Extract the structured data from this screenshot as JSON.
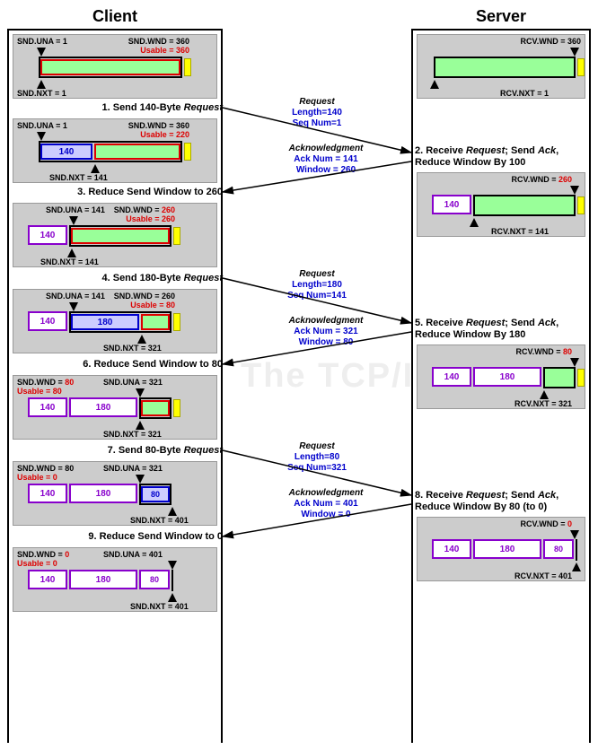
{
  "headers": {
    "client": "Client",
    "server": "Server"
  },
  "watermark": "The TCP/IP Guide",
  "steps": {
    "s1": "1. Send 140-Byte <em>Request</em>",
    "s2": "2. Receive <em>Request</em>; Send <em>Ack</em>, Reduce Window By 100",
    "s3": "3. Reduce Send Window to 260",
    "s4": "4. Send 180-Byte <em>Request</em>",
    "s5": "5. Receive <em>Request</em>; Send <em>Ack</em>, Reduce Window By 180",
    "s6": "6. Reduce Send Window to 80",
    "s7": "7. Send 80-Byte <em>Request</em>",
    "s8": "8. Receive <em>Request</em>; Send <em>Ack</em>, Reduce Window By 80 (to 0)",
    "s9": "9. Reduce Send Window to 0"
  },
  "msgs": {
    "req1": {
      "title": "Request",
      "l1": "Length=140",
      "l2": "Seq Num=1"
    },
    "ack1": {
      "title": "Acknowledgment",
      "l1": "Ack Num = 141",
      "l2": "Window = 260"
    },
    "req2": {
      "title": "Request",
      "l1": "Length=180",
      "l2": "Seq Num=141"
    },
    "ack2": {
      "title": "Acknowledgment",
      "l1": "Ack Num = 321",
      "l2": "Window = 80"
    },
    "req3": {
      "title": "Request",
      "l1": "Length=80",
      "l2": "Seq Num=321"
    },
    "ack3": {
      "title": "Acknowledgment",
      "l1": "Ack Num = 401",
      "l2": "Window = 0"
    }
  },
  "client_states": {
    "c1": {
      "snd_una": "SND.UNA = 1",
      "snd_wnd": "SND.WND = 360",
      "usable": "Usable = 360",
      "snd_nxt": "SND.NXT = 1"
    },
    "c2": {
      "snd_una": "SND.UNA = 1",
      "snd_wnd": "SND.WND = 360",
      "usable": "Usable = 220",
      "snd_nxt": "SND.NXT = 141",
      "seg1": "140"
    },
    "c3": {
      "snd_una": "SND.UNA = 141",
      "snd_wnd": "SND.WND = 260",
      "usable": "Usable = 260",
      "snd_nxt": "SND.NXT = 141",
      "seg1": "140"
    },
    "c4": {
      "snd_una": "SND.UNA = 141",
      "snd_wnd": "SND.WND = 260",
      "usable": "Usable = 80",
      "snd_nxt": "SND.NXT = 321",
      "seg1": "140",
      "seg2": "180"
    },
    "c5": {
      "snd_una": "SND.UNA = 321",
      "snd_wnd": "SND.WND = 80",
      "usable": "Usable = 80",
      "snd_nxt": "SND.NXT = 321",
      "seg1": "140",
      "seg2": "180"
    },
    "c6": {
      "snd_una": "SND.UNA = 321",
      "snd_wnd": "SND.WND = 80",
      "usable": "Usable = 0",
      "snd_nxt": "SND.NXT = 401",
      "seg1": "140",
      "seg2": "180",
      "seg3": "80"
    },
    "c7": {
      "snd_una": "SND.UNA = 401",
      "snd_wnd": "SND.WND = 0",
      "usable": "Usable = 0",
      "snd_nxt": "SND.NXT = 401",
      "seg1": "140",
      "seg2": "180",
      "seg3": "80"
    }
  },
  "server_states": {
    "r1": {
      "rcv_wnd": "RCV.WND = 360",
      "rcv_nxt": "RCV.NXT = 1"
    },
    "r2": {
      "rcv_wnd": "RCV.WND = 260",
      "rcv_nxt": "RCV.NXT = 141",
      "seg1": "140"
    },
    "r3": {
      "rcv_wnd": "RCV.WND = 80",
      "rcv_nxt": "RCV.NXT = 321",
      "seg1": "140",
      "seg2": "180"
    },
    "r4": {
      "rcv_wnd": "RCV.WND = 0",
      "rcv_nxt": "RCV.NXT = 401",
      "seg1": "140",
      "seg2": "180",
      "seg3": "80"
    },
    "r2_red": "260",
    "r3_red": "80",
    "r4_red": "0"
  }
}
